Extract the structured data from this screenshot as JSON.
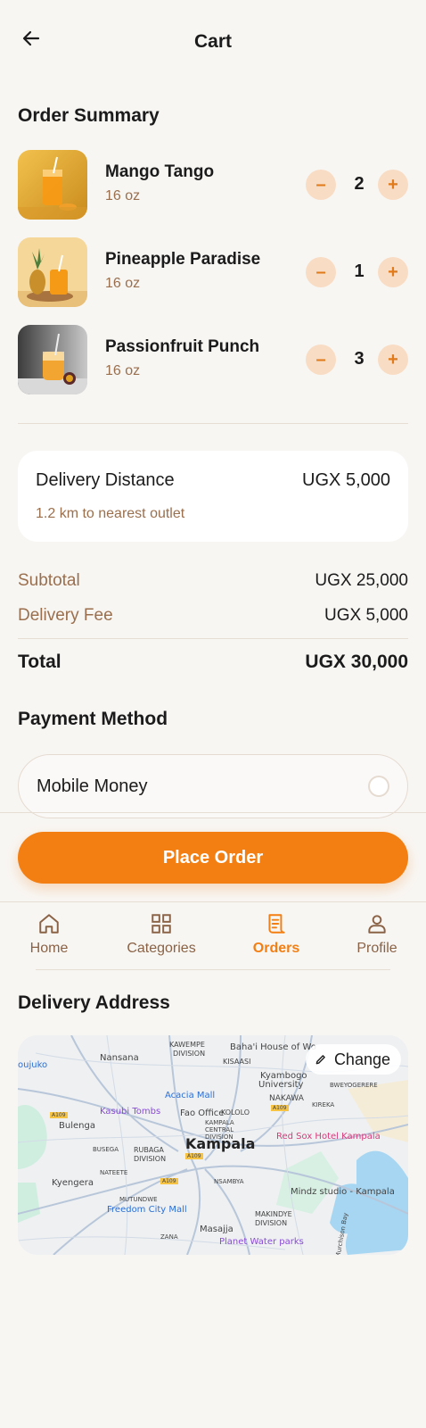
{
  "header": {
    "title": "Cart",
    "back_icon": "arrow-left-icon"
  },
  "order_summary": {
    "title": "Order Summary",
    "items": [
      {
        "name": "Mango Tango",
        "size": "16 oz",
        "quantity": "2"
      },
      {
        "name": "Pineapple Paradise",
        "size": "16 oz",
        "quantity": "1"
      },
      {
        "name": "Passionfruit Punch",
        "size": "16 oz",
        "quantity": "3"
      }
    ],
    "minus_label": "–",
    "plus_label": "+"
  },
  "delivery_card": {
    "label": "Delivery Distance",
    "value": "UGX 5,000",
    "note": "1.2 km to nearest outlet"
  },
  "totals": {
    "subtotal_label": "Subtotal",
    "subtotal_value": "UGX 25,000",
    "fee_label": "Delivery Fee",
    "fee_value": "UGX 5,000",
    "total_label": "Total",
    "total_value": "UGX 30,000"
  },
  "payment": {
    "title": "Payment Method",
    "selected": "Mobile Money"
  },
  "place_order_label": "Place Order",
  "nav": {
    "items": [
      {
        "label": "Home",
        "icon": "home-icon"
      },
      {
        "label": "Categories",
        "icon": "grid-icon"
      },
      {
        "label": "Orders",
        "icon": "receipt-icon"
      },
      {
        "label": "Profile",
        "icon": "user-icon"
      }
    ],
    "active": "Orders"
  },
  "delivery_address": {
    "title": "Delivery Address",
    "change_label": "Change",
    "map_labels": {
      "kampala": "Kampala",
      "nansana": "Nansana",
      "kawempe": "KAWEMPE",
      "kawempe2": "DIVISION",
      "bahai": "Baha'i House of Wo",
      "kisaasi": "KISAASI",
      "kyambogo": "Kyambogo",
      "kyambogo2": "University",
      "bwaise": "BWEYOGERERE",
      "acacia": "Acacia Mall",
      "kasubi": "Kasubi Tombs",
      "faooffice": "Fao Office",
      "kololo": "KOLOLO",
      "nakawa": "NAKAWA",
      "kireka": "KIREKA",
      "kampala_central": "KAMPALA",
      "central2": "CENTRAL",
      "central3": "DIVISION",
      "redsox": "Red Sox Hotel Kampala",
      "bulenga": "Bulenga",
      "busega": "BUSEGA",
      "rubaga": "RUBAGA",
      "rubaga2": "DIVISION",
      "nateete": "NATEETE",
      "kyengera": "Kyengera",
      "mutundwe": "MUTUNDWE",
      "freedom": "Freedom City Mall",
      "nsambya": "NSAMBYA",
      "mindz": "Mindz studio - Kampala",
      "makindye": "MAKINDYE",
      "makindye2": "DIVISION",
      "zana": "ZANA",
      "masajja": "Masajja",
      "planet": "Planet Water parks",
      "murchison": "Murchison Bay",
      "a109a": "A109",
      "a109b": "A109",
      "a109c": "A109",
      "a109d": "A109",
      "kajjansi": "oujuko"
    }
  },
  "colors": {
    "accent": "#f37f12",
    "accent_soft": "#f9dcc4",
    "muted_text": "#9a6f4e",
    "background": "#f8f6f3"
  }
}
